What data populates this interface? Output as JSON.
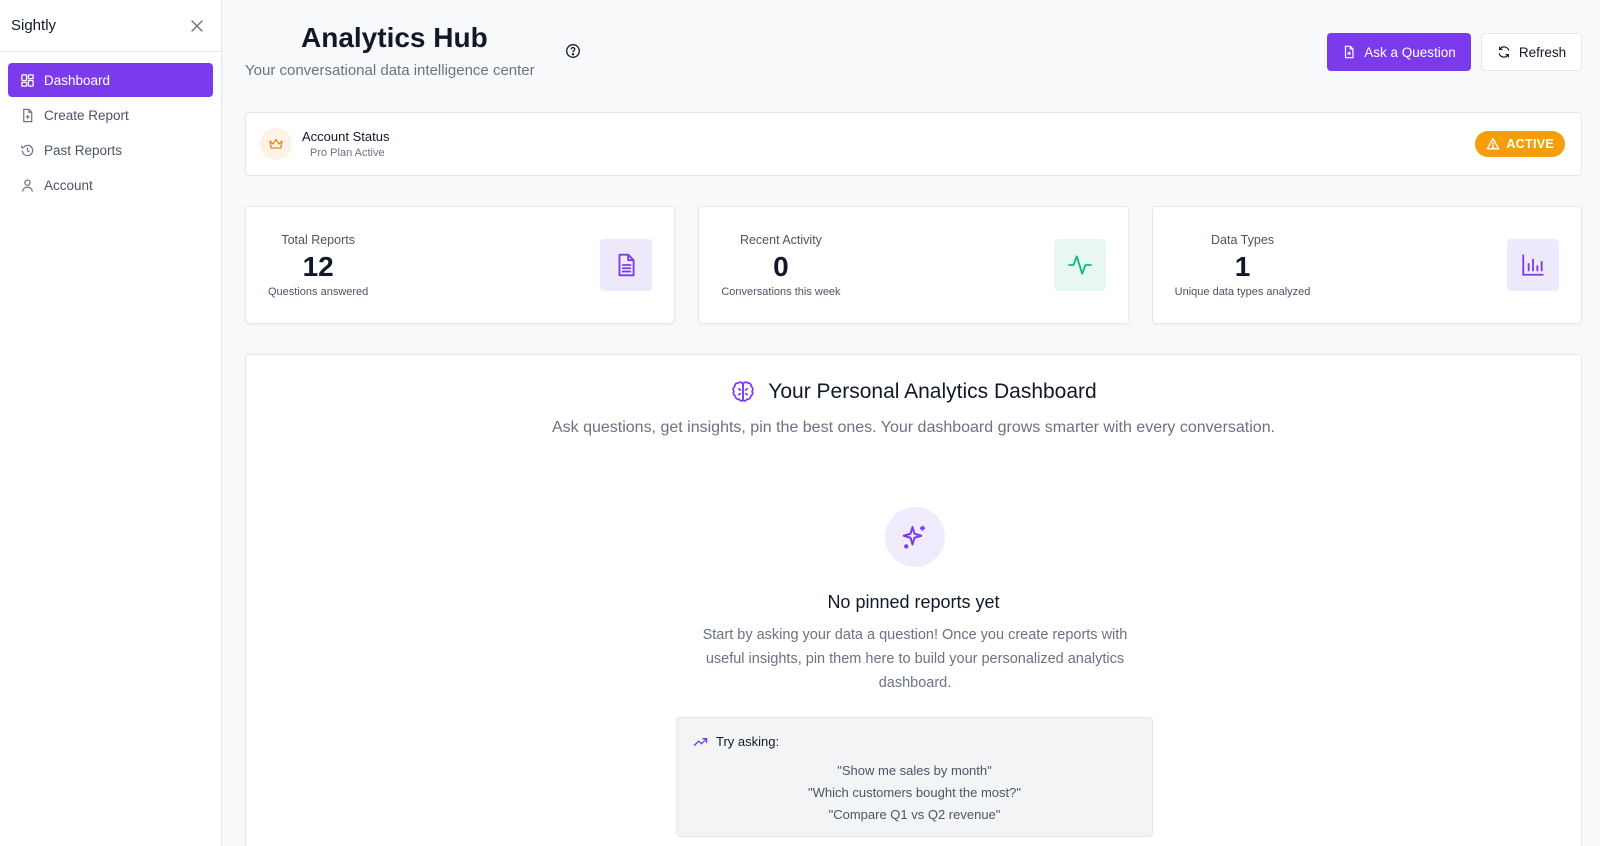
{
  "sidebar": {
    "brand": "Sightly",
    "items": [
      {
        "label": "Dashboard",
        "icon": "dashboard-icon",
        "active": true
      },
      {
        "label": "Create Report",
        "icon": "file-plus-icon",
        "active": false
      },
      {
        "label": "Past Reports",
        "icon": "history-icon",
        "active": false
      },
      {
        "label": "Account",
        "icon": "user-icon",
        "active": false
      }
    ]
  },
  "header": {
    "title": "Analytics Hub",
    "subtitle": "Your conversational data intelligence center",
    "ask_label": "Ask a Question",
    "refresh_label": "Refresh"
  },
  "account_status": {
    "title": "Account Status",
    "plan": "Pro Plan Active",
    "badge": "ACTIVE"
  },
  "stats": [
    {
      "label": "Total Reports",
      "value": "12",
      "sub": "Questions answered",
      "icon": "document-icon"
    },
    {
      "label": "Recent Activity",
      "value": "0",
      "sub": "Conversations this week",
      "icon": "activity-icon"
    },
    {
      "label": "Data Types",
      "value": "1",
      "sub": "Unique data types analyzed",
      "icon": "bar-chart-icon"
    }
  ],
  "dashboard": {
    "title": "Your Personal Analytics Dashboard",
    "subtitle": "Ask questions, get insights, pin the best ones. Your dashboard grows smarter with every conversation.",
    "empty_title": "No pinned reports yet",
    "empty_desc": "Start by asking your data a question! Once you create reports with useful insights, pin them here to build your personalized analytics dashboard.",
    "try_heading": "Try asking:",
    "suggestions": [
      "\"Show me sales by month\"",
      "\"Which customers bought the most?\"",
      "\"Compare Q1 vs Q2 revenue\""
    ]
  },
  "colors": {
    "accent": "#7c3aed",
    "badge": "#f59e0b",
    "activity": "#10b981"
  }
}
